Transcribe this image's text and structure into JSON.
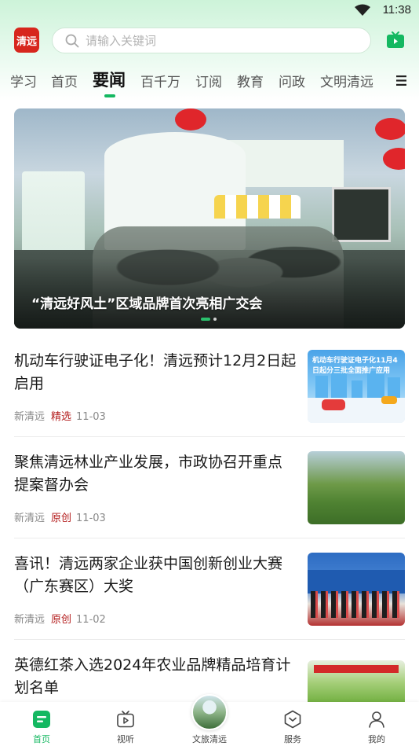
{
  "status_bar": {
    "time": "11:38"
  },
  "header": {
    "logo_text": "清远",
    "search_placeholder": "请输入关键词"
  },
  "tabs": [
    {
      "label": "学习",
      "active": false
    },
    {
      "label": "首页",
      "active": false
    },
    {
      "label": "要闻",
      "active": true
    },
    {
      "label": "百千万",
      "active": false
    },
    {
      "label": "订阅",
      "active": false
    },
    {
      "label": "教育",
      "active": false
    },
    {
      "label": "问政",
      "active": false
    },
    {
      "label": "文明清远",
      "active": false
    }
  ],
  "banner": {
    "caption": "“清远好风土”区域品牌首次亮相广交会",
    "slide_count": 2,
    "active_slide": 1
  },
  "news": [
    {
      "title": "机动车行驶证电子化！清远预计12月2日起启用",
      "source": "新清远",
      "tag": "精选",
      "date": "11-03",
      "thumb_text": "机动车行驶证电子化11月4日起分三批全面推广应用"
    },
    {
      "title": "聚焦清远林业产业发展，市政协召开重点提案督办会",
      "source": "新清远",
      "tag": "原创",
      "date": "11-03"
    },
    {
      "title": "喜讯！清远两家企业获中国创新创业大赛（广东赛区）大奖",
      "source": "新清远",
      "tag": "原创",
      "date": "11-02"
    },
    {
      "title": "英德红茶入选2024年农业品牌精品培育计划名单"
    }
  ],
  "bottom_nav": [
    {
      "label": "首页",
      "icon": "home-icon",
      "active": true
    },
    {
      "label": "视听",
      "icon": "tv-icon",
      "active": false
    },
    {
      "label": "文旅清远",
      "icon": "tourism-image",
      "active": false
    },
    {
      "label": "服务",
      "icon": "service-icon",
      "active": false
    },
    {
      "label": "我的",
      "icon": "user-icon",
      "active": false
    }
  ],
  "colors": {
    "accent": "#14b861",
    "tag_red": "#b41e1e",
    "logo_red": "#d7261d"
  }
}
